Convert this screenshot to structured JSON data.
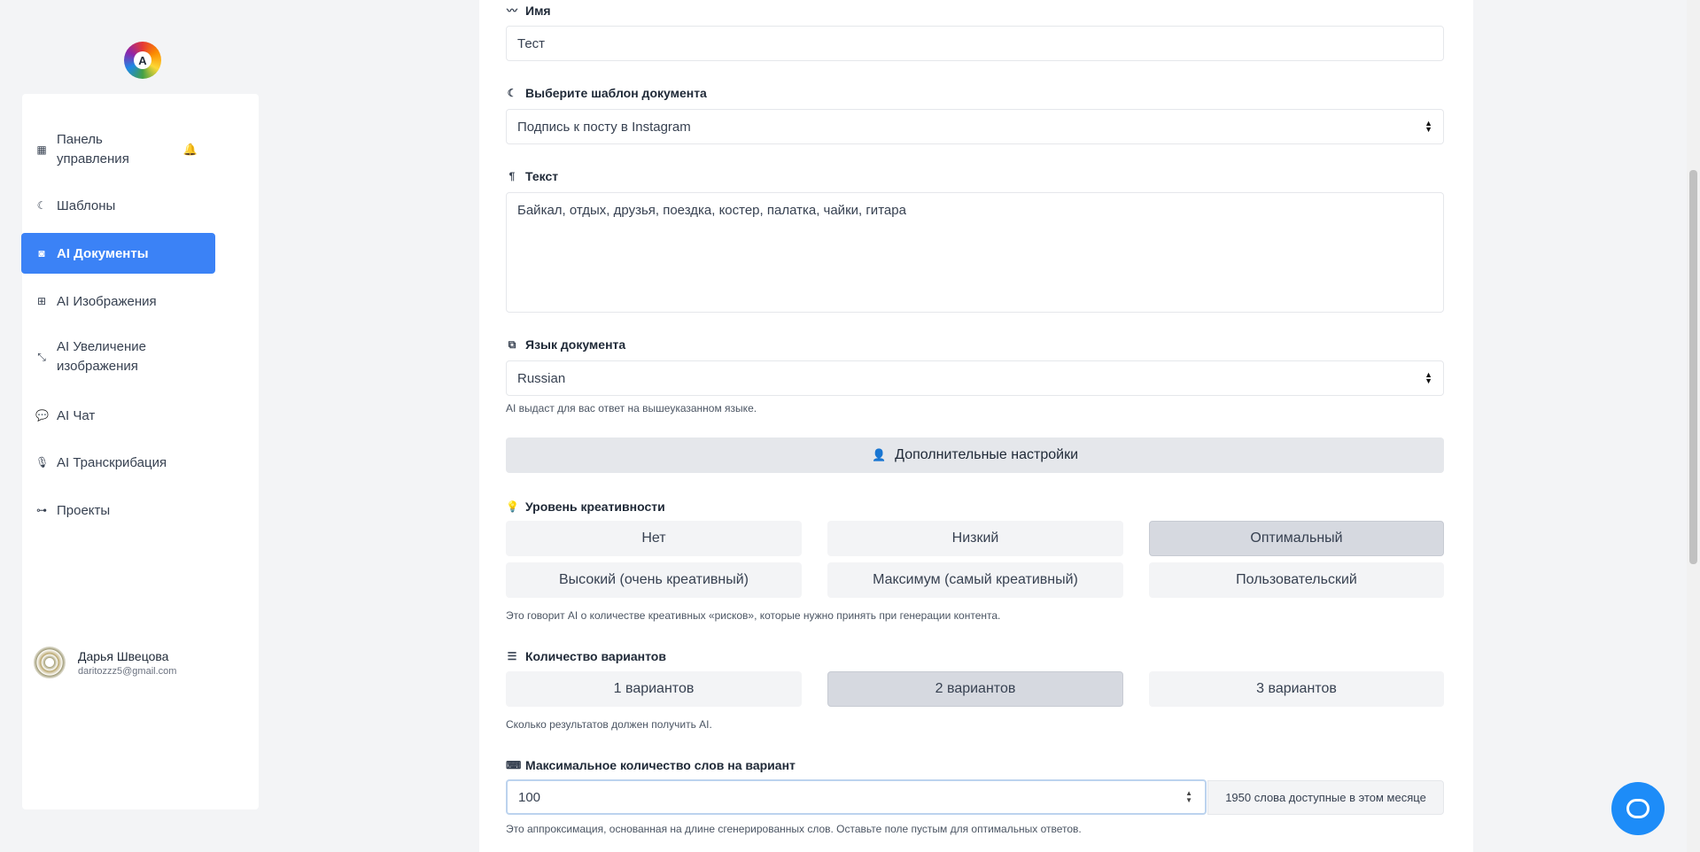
{
  "logo": {
    "letter": "A"
  },
  "sidebar": {
    "items": [
      {
        "label": "Панель управления",
        "icon": "grid-icon"
      },
      {
        "label": "Шаблоны",
        "icon": "moon-icon"
      },
      {
        "label": "AI Документы",
        "icon": "robot-icon",
        "active": true
      },
      {
        "label": "AI Изображения",
        "icon": "image-icon"
      },
      {
        "label": "AI Увеличение изображения",
        "icon": "expand-icon"
      },
      {
        "label": "AI Чат",
        "icon": "chat-icon"
      },
      {
        "label": "AI Транскрибация",
        "icon": "microphone-icon"
      },
      {
        "label": "Проекты",
        "icon": "project-diagram-icon"
      }
    ],
    "user": {
      "name": "Дарья Швецова",
      "email": "daritozzz5@gmail.com"
    }
  },
  "form": {
    "name": {
      "label": "Имя",
      "value": "Тест"
    },
    "template": {
      "label": "Выберите шаблон документа",
      "value": "Подпись к посту в Instagram"
    },
    "text": {
      "label": "Текст",
      "value": "Байкал, отдых, друзья, поездка, костер, палатка, чайки, гитара"
    },
    "language": {
      "label": "Язык документа",
      "value": "Russian",
      "hint": "AI выдаст для вас ответ на вышеуказанном языке."
    },
    "advanced_button": "Дополнительные настройки",
    "creativity": {
      "label": "Уровень креативности",
      "options": [
        "Нет",
        "Низкий",
        "Оптимальный",
        "Высокий (очень креативный)",
        "Максимум (самый креативный)",
        "Пользовательский"
      ],
      "selected": "Оптимальный",
      "hint": "Это говорит AI о количестве креативных «рисков», которые нужно принять при генерации контента."
    },
    "variants": {
      "label": "Количество вариантов",
      "options": [
        "1 вариантов",
        "2 вариантов",
        "3 вариантов"
      ],
      "selected": "2 вариантов",
      "hint": "Сколько результатов должен получить AI."
    },
    "max_words": {
      "label": "Максимальное количество слов на вариант",
      "value": "100",
      "addon": "1950 слова доступные в этом месяце",
      "hint": "Это аппроксимация, основанная на длине сгенерированных слов. Оставьте поле пустым для оптимальных ответов."
    }
  },
  "colors": {
    "accent": "#3b82f6",
    "chat": "#1d8cf8"
  }
}
